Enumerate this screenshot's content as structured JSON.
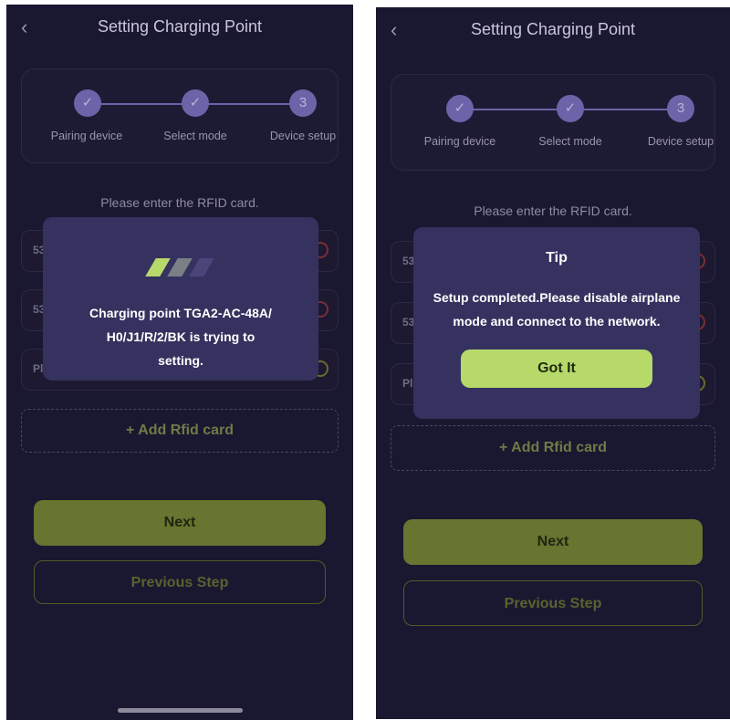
{
  "header": {
    "title": "Setting Charging Point",
    "back_icon": "chevron-left-icon"
  },
  "steps": [
    {
      "label": "Pairing device",
      "state": "done",
      "mark": "✓"
    },
    {
      "label": "Select mode",
      "state": "done",
      "mark": "✓"
    },
    {
      "label": "Device setup",
      "state": "current",
      "mark": "3"
    }
  ],
  "prompt": "Please enter the RFID card.",
  "rfid_rows": [
    {
      "prefix": "53"
    },
    {
      "prefix": "53"
    },
    {
      "prefix": "Pl"
    }
  ],
  "add_rfid_label": "+  Add Rfid card",
  "next_label": "Next",
  "previous_label": "Previous Step",
  "loading_modal": {
    "message": "Charging point TGA2-AC-48A/ H0/J1/R/2/BK is trying to setting.",
    "line1": "Charging point TGA2-AC-48A/",
    "line2": "H0/J1/R/2/BK is trying to",
    "line3": "setting."
  },
  "tip_modal": {
    "title": "Tip",
    "line1": "Setup completed.Please disable airplane",
    "line2": "mode and connect to the network.",
    "button_label": "Got It"
  },
  "colors": {
    "screen_bg": "#1a1730",
    "modal_bg": "#35325f",
    "accent_green": "#b6d96a",
    "step_purple": "#6b64a8"
  }
}
